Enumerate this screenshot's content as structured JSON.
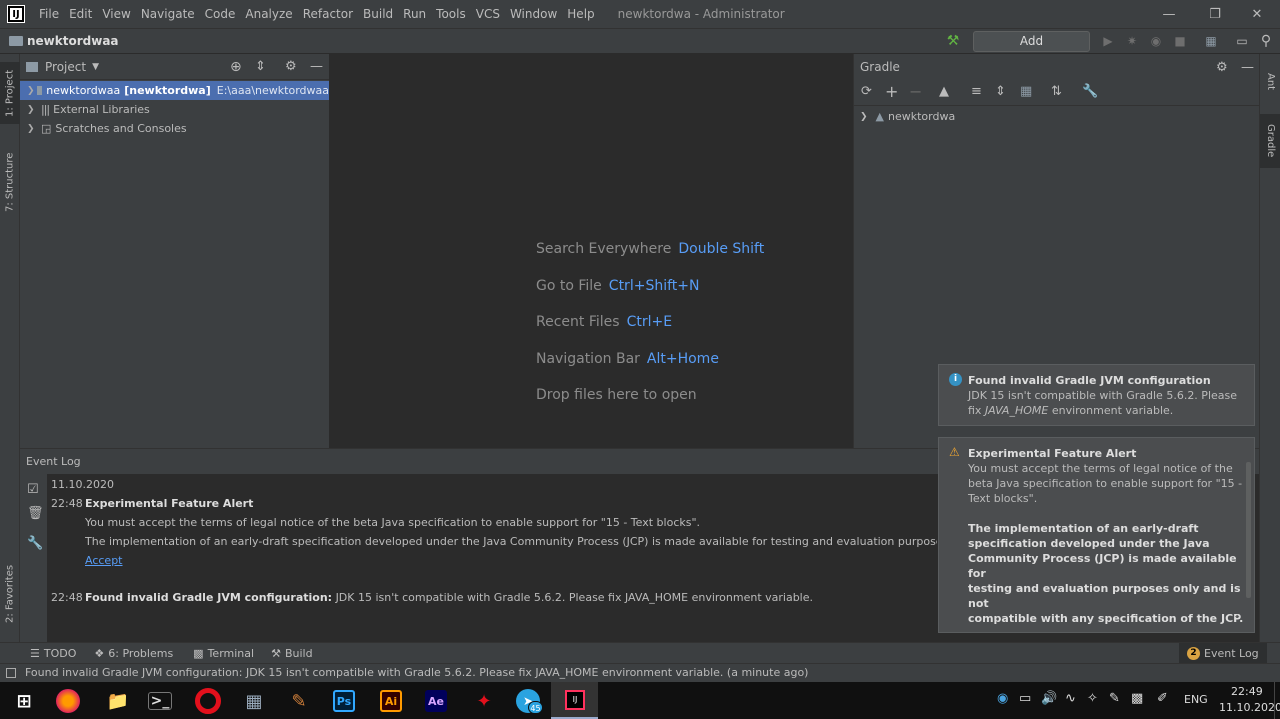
{
  "menu": [
    "File",
    "Edit",
    "View",
    "Navigate",
    "Code",
    "Analyze",
    "Refactor",
    "Build",
    "Run",
    "Tools",
    "VCS",
    "Window",
    "Help"
  ],
  "window_title": "newktordwa - Administrator",
  "nav": {
    "project": "newktordwaa",
    "add_config": "Add Configuration..."
  },
  "left_tabs": {
    "project": "1: Project",
    "structure": "7: Structure",
    "favorites": "2: Favorites"
  },
  "right_tabs": {
    "ant": "Ant",
    "gradle": "Gradle"
  },
  "project_panel": {
    "title": "Project",
    "tree": [
      {
        "name": "newktordwaa",
        "bold": "[newktordwa]",
        "path": "E:\\aaa\\newktordwaa"
      },
      {
        "name": "External Libraries"
      },
      {
        "name": "Scratches and Consoles"
      }
    ]
  },
  "editor_hints": [
    {
      "label": "Search Everywhere",
      "key": "Double Shift"
    },
    {
      "label": "Go to File",
      "key": "Ctrl+Shift+N"
    },
    {
      "label": "Recent Files",
      "key": "Ctrl+E"
    },
    {
      "label": "Navigation Bar",
      "key": "Alt+Home"
    },
    {
      "label": "Drop files here to open",
      "key": ""
    }
  ],
  "gradle_panel": {
    "title": "Gradle",
    "root": "newktordwa"
  },
  "event_log": {
    "title": "Event Log",
    "date": "11.10.2020",
    "entry1_time": "22:48",
    "entry1_title": "Experimental Feature Alert",
    "entry1_line1": "You must accept the terms of legal notice of the beta Java specification to enable support for \"15 - Text blocks\".",
    "entry1_line2": "The implementation of an early-draft specification developed under the Java Community Process (JCP) is made available for testing and evaluation purposes only and is not c",
    "entry1_link": "Accept",
    "entry2_time": "22:48",
    "entry2_title": "Found invalid Gradle JVM configuration:",
    "entry2_text": "JDK 15 isn't compatible with Gradle 5.6.2. Please fix JAVA_HOME environment variable."
  },
  "balloon1": {
    "title": "Found invalid Gradle JVM configuration",
    "line1": "JDK 15 isn't compatible with Gradle 5.6.2. Please",
    "line2_pre": "fix ",
    "line2_em": "JAVA_HOME",
    "line2_post": " environment variable."
  },
  "balloon2": {
    "title": "Experimental Feature Alert",
    "line1": "You must accept the terms of legal notice of the",
    "line2": "beta Java specification to enable support for \"15 -",
    "line3": "Text blocks\".",
    "b1": "The implementation of an early-draft",
    "b2": "specification developed under the Java",
    "b3": "Community Process (JCP) is made available for",
    "b4": "testing and evaluation purposes only and is not",
    "b5": "compatible with any specification of the JCP."
  },
  "bottom_tabs": {
    "todo": "TODO",
    "problems": "6: Problems",
    "terminal": "Terminal",
    "build": "Build",
    "event_log": "Event Log",
    "event_count": "2"
  },
  "status": "Found invalid Gradle JVM configuration: JDK 15 isn't compatible with Gradle 5.6.2. Please fix JAVA_HOME environment variable. (a minute ago)",
  "taskbar": {
    "lang": "ENG",
    "time": "22:49",
    "date": "11.10.2020",
    "telegram_badge": "45",
    "ps": "Ps",
    "ai": "Ai",
    "ae": "Ae"
  }
}
